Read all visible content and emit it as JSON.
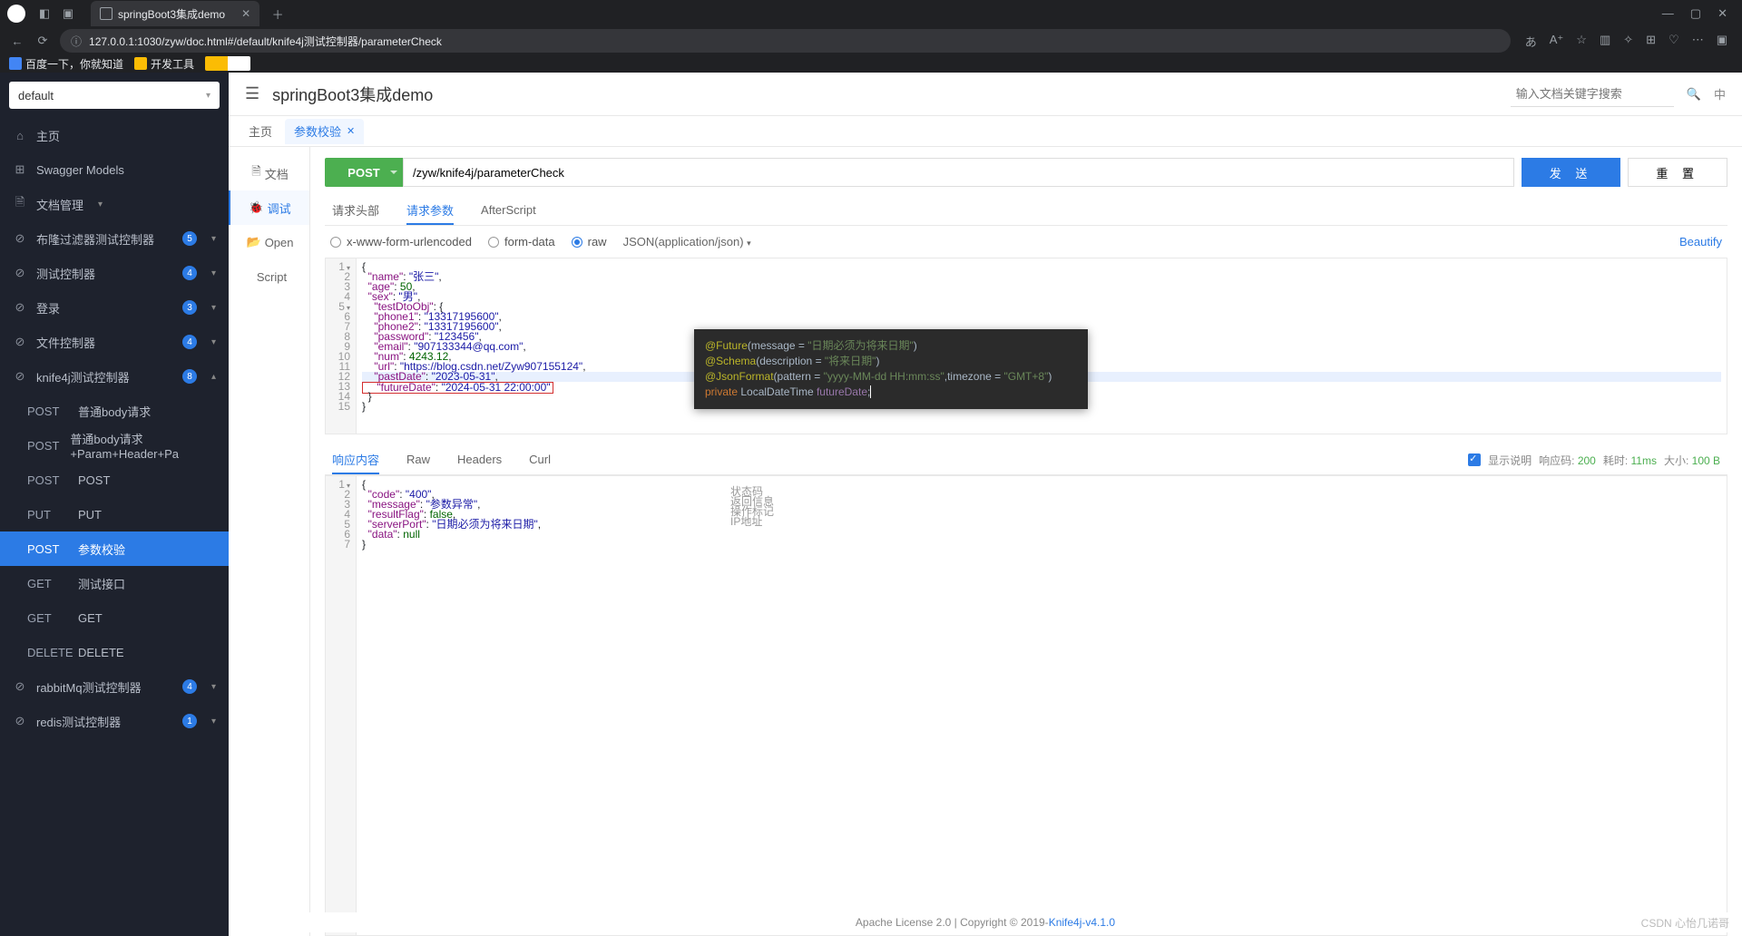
{
  "browser": {
    "tab_title": "springBoot3集成demo",
    "url": "127.0.0.1:1030/zyw/doc.html#/default/knife4j测试控制器/parameterCheck",
    "bookmarks": [
      "百度一下，你就知道",
      "开发工具"
    ]
  },
  "app": {
    "title": "springBoot3集成demo",
    "search_placeholder": "输入文档关键字搜索",
    "group_select": "default"
  },
  "sidebar": {
    "items": [
      {
        "icon": "⌂",
        "label": "主页"
      },
      {
        "icon": "⊞",
        "label": "Swagger Models"
      },
      {
        "icon": "🗎",
        "label": "文档管理",
        "arrow": "▾"
      },
      {
        "icon": "⊘",
        "label": "布隆过滤器测试控制器",
        "count": "5",
        "arrow": "▾"
      },
      {
        "icon": "⊘",
        "label": "测试控制器",
        "count": "4",
        "arrow": "▾"
      },
      {
        "icon": "⊘",
        "label": "登录",
        "count": "3",
        "arrow": "▾"
      },
      {
        "icon": "⊘",
        "label": "文件控制器",
        "count": "4",
        "arrow": "▾"
      },
      {
        "icon": "⊘",
        "label": "knife4j测试控制器",
        "count": "8",
        "arrow": "▴",
        "expanded": true
      }
    ],
    "subs": [
      {
        "m": "POST",
        "t": "普通body请求"
      },
      {
        "m": "POST",
        "t": "普通body请求+Param+Header+Pa"
      },
      {
        "m": "POST",
        "t": "POST"
      },
      {
        "m": "PUT",
        "t": "PUT"
      },
      {
        "m": "POST",
        "t": "参数校验",
        "active": true
      },
      {
        "m": "GET",
        "t": "测试接口"
      },
      {
        "m": "GET",
        "t": "GET"
      },
      {
        "m": "DELETE",
        "t": "DELETE"
      }
    ],
    "tail": [
      {
        "icon": "⊘",
        "label": "rabbitMq测试控制器",
        "count": "4",
        "arrow": "▾"
      },
      {
        "icon": "⊘",
        "label": "redis测试控制器",
        "count": "1",
        "arrow": "▾"
      }
    ]
  },
  "tabs": [
    {
      "label": "主页"
    },
    {
      "label": "参数校验",
      "active": true,
      "closable": true
    }
  ],
  "left_menu": [
    {
      "ic": "🗎",
      "label": "文档"
    },
    {
      "ic": "🐞",
      "label": "调试",
      "active": true
    },
    {
      "ic": "📂",
      "label": "Open"
    },
    {
      "ic": "</>",
      "label": "Script"
    }
  ],
  "request": {
    "method": "POST",
    "url": "/zyw/knife4j/parameterCheck",
    "send": "发 送",
    "reset": "重 置"
  },
  "req_tabs": [
    "请求头部",
    "请求参数",
    "AfterScript"
  ],
  "req_tab_active": 1,
  "body_types": [
    "x-www-form-urlencoded",
    "form-data",
    "raw"
  ],
  "body_type_sel": 2,
  "content_type": "JSON(application/json)",
  "beautify": "Beautify",
  "req_json": {
    "lines": [
      "{",
      "  \"name\": \"张三\",",
      "  \"age\": 50,",
      "  \"sex\": \"男\",",
      "    \"testDtoObj\": {",
      "    \"phone1\": \"13317195600\",",
      "    \"phone2\": \"13317195600\",",
      "    \"password\": \"123456\",",
      "    \"email\": \"907133344@qq.com\",",
      "    \"num\": 4243.12,",
      "    \"url\": \"https://blog.csdn.net/Zyw907155124\",",
      "    \"pastDate\": \"2023-05-31\",",
      "    \"futureDate\": \"2024-05-31 22:00:00\"",
      "  }",
      "}"
    ],
    "hl_line": 12,
    "boxed_line": 13
  },
  "overlay": {
    "lines": [
      {
        "pre": "@Future",
        "paren": "(message = ",
        "str": "\"日期必须为将来日期\"",
        "post": ")"
      },
      {
        "pre": "@Schema",
        "paren": "(description = ",
        "str": "\"将来日期\"",
        "post": ")"
      },
      {
        "pre": "@JsonFormat",
        "paren": "(pattern = ",
        "str": "\"yyyy-MM-dd HH:mm:ss\"",
        "mid": ",timezone = ",
        "str2": "\"GMT+8\"",
        "post": ")"
      },
      {
        "kw": "private ",
        "ty": "LocalDateTime ",
        "fd": "futureDate",
        "post": ";"
      }
    ]
  },
  "resp_tabs": [
    "响应内容",
    "Raw",
    "Headers",
    "Curl"
  ],
  "resp_tab_active": 0,
  "resp_meta": {
    "show": "显示说明",
    "code_lbl": "响应码:",
    "code": "200",
    "time_lbl": "耗时:",
    "time": "11ms",
    "size_lbl": "大小:",
    "size": "100 B"
  },
  "resp_json": {
    "lines": [
      "{",
      "  \"code\": \"400\",",
      "  \"message\": \"参数异常\",",
      "  \"resultFlag\": false,",
      "  \"serverPort\": \"日期必须为将来日期\",",
      "  \"data\": null",
      "}"
    ]
  },
  "resp_hints": [
    "状态码",
    "返回信息",
    "操作标记",
    "IP地址"
  ],
  "footer": {
    "text": "Apache License 2.0 | Copyright © 2019-",
    "link": "Knife4j-v4.1.0"
  },
  "watermark": "CSDN 心怡几诺哥"
}
